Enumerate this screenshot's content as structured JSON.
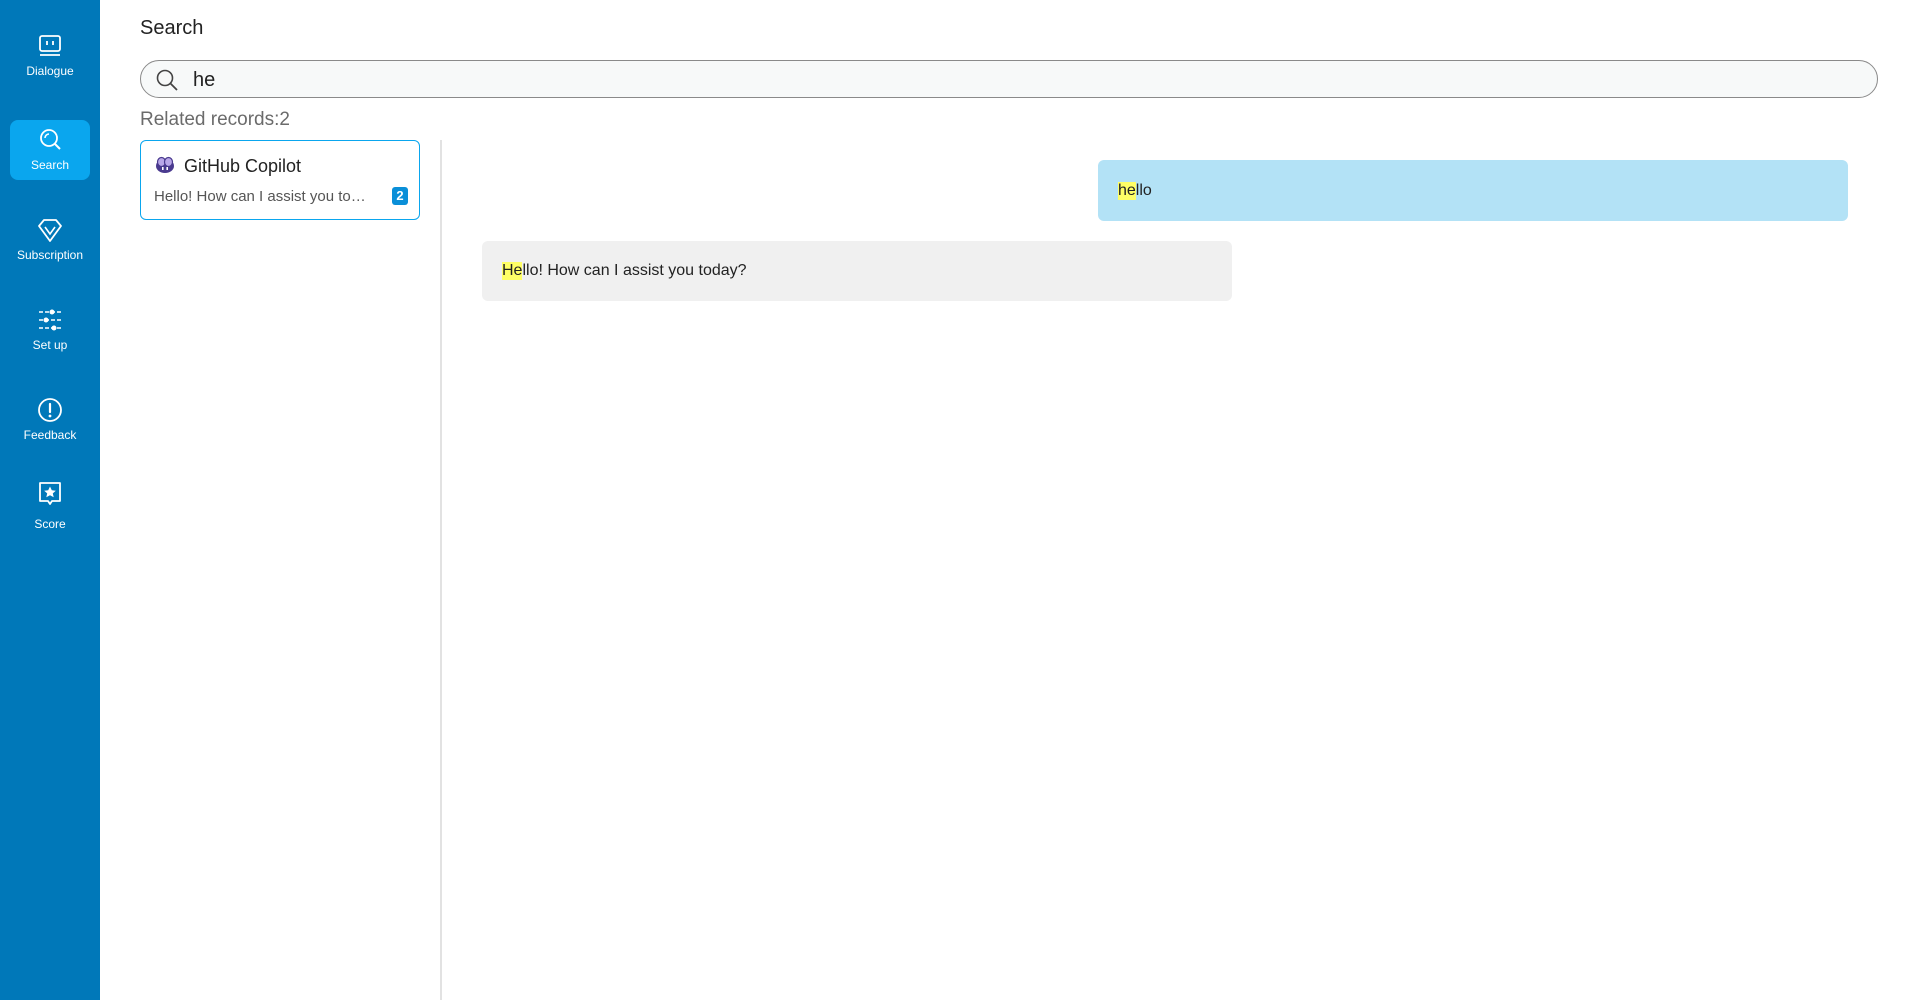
{
  "sidebar": {
    "items": [
      {
        "label": "Dialogue",
        "icon": "dialogue-icon",
        "active": false
      },
      {
        "label": "Search",
        "icon": "search-icon",
        "active": true
      },
      {
        "label": "Subscription",
        "icon": "diamond-icon",
        "active": false
      },
      {
        "label": "Set up",
        "icon": "sliders-icon",
        "active": false
      },
      {
        "label": "Feedback",
        "icon": "exclamation-icon",
        "active": false
      },
      {
        "label": "Score",
        "icon": "star-icon",
        "active": false
      }
    ],
    "background": "#0078b9",
    "active_background": "#0aa6ee"
  },
  "page": {
    "title": "Search"
  },
  "search": {
    "value": "he",
    "icon": "search-icon"
  },
  "results": {
    "related_label": "Related records:2",
    "records": [
      {
        "title": "GitHub Copilot",
        "preview": "Hello! How can I assist you today?",
        "count": "2",
        "icon": "copilot-icon"
      }
    ]
  },
  "conversation": {
    "messages": [
      {
        "role": "user",
        "highlight": "he",
        "rest": "llo",
        "background": "#b3e2f6"
      },
      {
        "role": "assistant",
        "highlight": "He",
        "rest": "llo! How can I assist you today?",
        "background": "#f0f0f0"
      }
    ],
    "highlight_color": "#ffff66"
  }
}
